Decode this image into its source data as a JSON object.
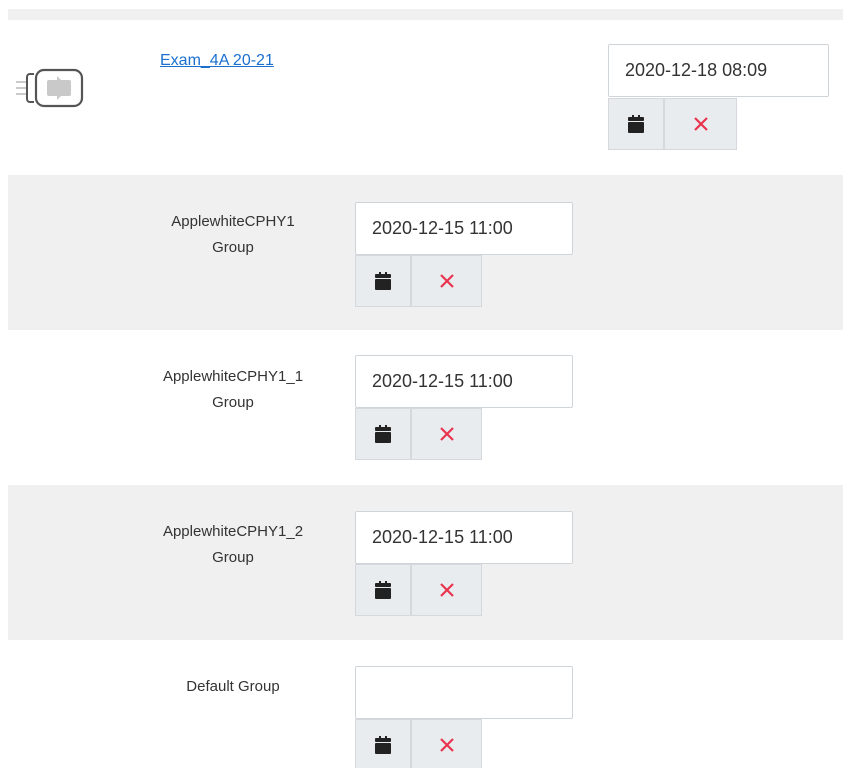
{
  "activity": {
    "link_text": "Exam_4A 20-21",
    "due_date": "2020-12-18 08:09",
    "icon": "assignment-arrow-icon"
  },
  "groups": [
    {
      "name_line1": "ApplewhiteCPHY1",
      "name_line2": "Group",
      "date": "2020-12-15 11:00"
    },
    {
      "name_line1": "ApplewhiteCPHY1_1",
      "name_line2": "Group",
      "date": "2020-12-15 11:00"
    },
    {
      "name_line1": "ApplewhiteCPHY1_2",
      "name_line2": "Group",
      "date": "2020-12-15 11:00"
    },
    {
      "name_line1": "Default Group",
      "name_line2": "",
      "date": ""
    }
  ],
  "icons": {
    "calendar": "calendar-icon",
    "clear": "x-icon"
  },
  "colors": {
    "link": "#1a6fcf",
    "clear_x": "#e8344e",
    "shaded_row": "#f0f0f0",
    "button_bg": "#e9ecef"
  }
}
